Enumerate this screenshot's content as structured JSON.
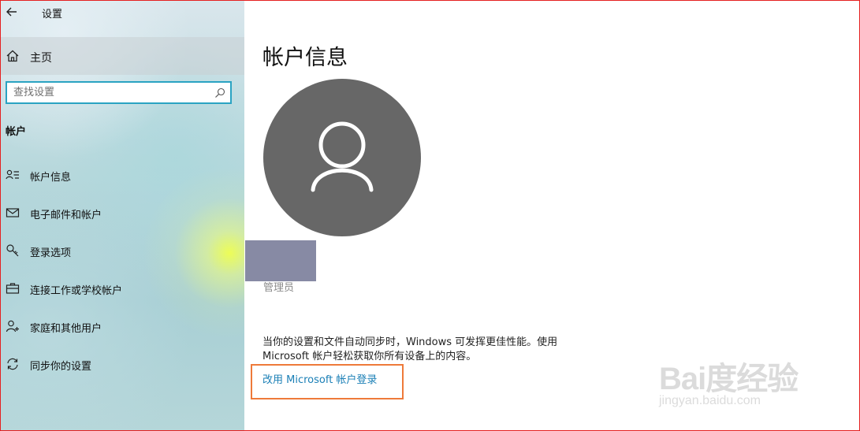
{
  "titlebar": {
    "back_icon": "back-arrow-icon",
    "title": "设置"
  },
  "sidebar": {
    "home": {
      "icon": "home-icon",
      "label": "主页"
    },
    "search": {
      "placeholder": "查找设置",
      "icon": "search-icon"
    },
    "section_heading": "帐户",
    "items": [
      {
        "icon": "account-info-icon",
        "label": "帐户信息"
      },
      {
        "icon": "email-icon",
        "label": "电子邮件和帐户"
      },
      {
        "icon": "key-icon",
        "label": "登录选项"
      },
      {
        "icon": "briefcase-icon",
        "label": "连接工作或学校帐户"
      },
      {
        "icon": "person-add-icon",
        "label": "家庭和其他用户"
      },
      {
        "icon": "sync-icon",
        "label": "同步你的设置"
      }
    ]
  },
  "main": {
    "page_title": "帐户信息",
    "avatar_icon": "user-avatar-icon",
    "role": "管理员",
    "sync_text": "当你的设置和文件自动同步时，Windows 可发挥更佳性能。使用 Microsoft 帐户轻松获取你所有设备上的内容。",
    "switch_link": "改用 Microsoft 帐户登录"
  },
  "colors": {
    "accent": "#2aa3c2",
    "link": "#1a7fb6",
    "highlight_box": "#ee7a3a",
    "avatar_bg": "#676767",
    "redaction": "#878aa4"
  },
  "watermark": {
    "brand": "Bai度经验",
    "url": "jingyan.baidu.com"
  }
}
